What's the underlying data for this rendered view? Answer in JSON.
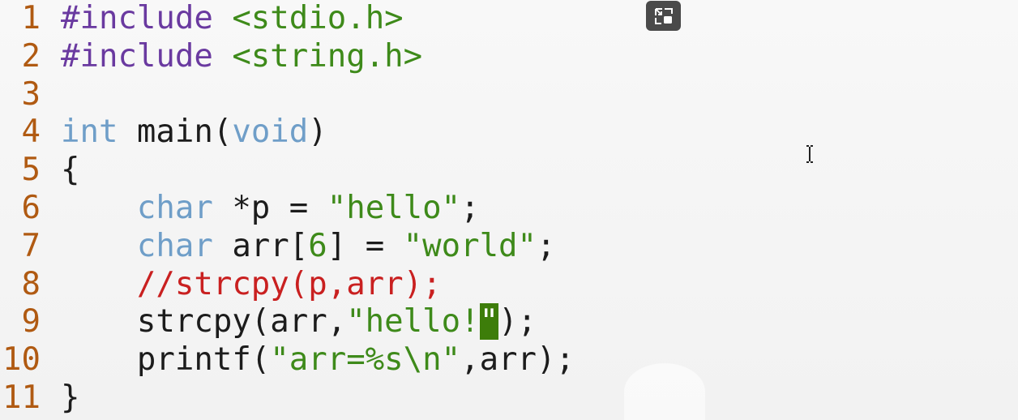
{
  "editor": {
    "lines": [
      {
        "n": "1",
        "tokens": [
          {
            "t": "#include ",
            "k": "pre"
          },
          {
            "t": "<stdio.h>",
            "k": "inc"
          }
        ]
      },
      {
        "n": "2",
        "tokens": [
          {
            "t": "#include ",
            "k": "pre"
          },
          {
            "t": "<string.h>",
            "k": "inc"
          }
        ]
      },
      {
        "n": "3",
        "tokens": []
      },
      {
        "n": "4",
        "tokens": [
          {
            "t": "int",
            "k": "type"
          },
          {
            "t": " main(",
            "k": "plain"
          },
          {
            "t": "void",
            "k": "type"
          },
          {
            "t": ")",
            "k": "plain"
          }
        ]
      },
      {
        "n": "5",
        "tokens": [
          {
            "t": "{",
            "k": "plain"
          }
        ]
      },
      {
        "n": "6",
        "tokens": [
          {
            "t": "    ",
            "k": "plain"
          },
          {
            "t": "char",
            "k": "type"
          },
          {
            "t": " *p = ",
            "k": "plain"
          },
          {
            "t": "\"hello\"",
            "k": "str"
          },
          {
            "t": ";",
            "k": "plain"
          }
        ]
      },
      {
        "n": "7",
        "tokens": [
          {
            "t": "    ",
            "k": "plain"
          },
          {
            "t": "char",
            "k": "type"
          },
          {
            "t": " arr[",
            "k": "plain"
          },
          {
            "t": "6",
            "k": "num"
          },
          {
            "t": "] = ",
            "k": "plain"
          },
          {
            "t": "\"world\"",
            "k": "str"
          },
          {
            "t": ";",
            "k": "plain"
          }
        ]
      },
      {
        "n": "8",
        "tokens": [
          {
            "t": "    ",
            "k": "plain"
          },
          {
            "t": "//strcpy(p,arr);",
            "k": "cmt"
          }
        ]
      },
      {
        "n": "9",
        "tokens": [
          {
            "t": "    strcpy(arr,",
            "k": "plain"
          },
          {
            "t": "\"hello!",
            "k": "str"
          },
          {
            "t": "\"",
            "k": "cursor"
          },
          {
            "t": ");",
            "k": "plain"
          }
        ]
      },
      {
        "n": "10",
        "tokens": [
          {
            "t": "    printf(",
            "k": "plain"
          },
          {
            "t": "\"arr=%s\\n\"",
            "k": "str"
          },
          {
            "t": ",arr);",
            "k": "plain"
          }
        ]
      },
      {
        "n": "11",
        "tokens": [
          {
            "t": "}",
            "k": "plain"
          }
        ]
      }
    ]
  },
  "overlay": {
    "pip_button_icon": "picture-in-picture-icon",
    "cursor_icon": "text-cursor-icon"
  },
  "colors": {
    "background": "#f5f5f5",
    "line_number": "#b05a12",
    "preprocessor": "#6a3aa0",
    "include_path": "#3e8a1a",
    "type_keyword": "#6f9ec8",
    "string": "#3e8a1a",
    "comment": "#c92020",
    "cursor_block": "#3d7d0a"
  }
}
